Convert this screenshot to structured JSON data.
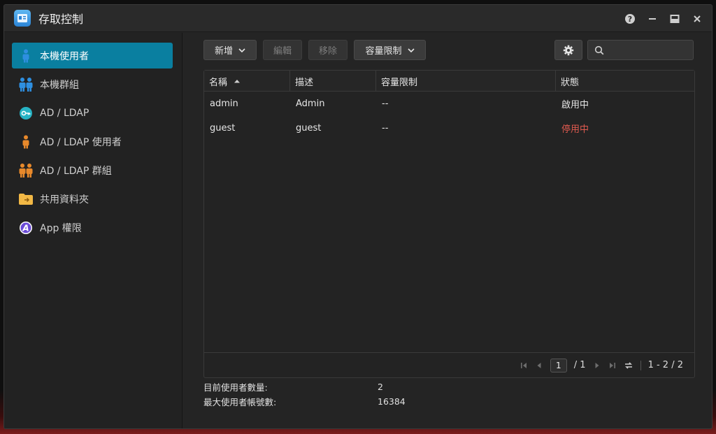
{
  "window": {
    "title": "存取控制"
  },
  "sidebar": {
    "items": [
      {
        "label": "本機使用者",
        "icon": "user-icon",
        "active": true
      },
      {
        "label": "本機群組",
        "icon": "group-icon",
        "active": false
      },
      {
        "label": "AD / LDAP",
        "icon": "key-icon",
        "active": false
      },
      {
        "label": "AD / LDAP 使用者",
        "icon": "user-icon",
        "active": false
      },
      {
        "label": "AD / LDAP 群組",
        "icon": "group-icon",
        "active": false
      },
      {
        "label": "共用資料夾",
        "icon": "folder-icon",
        "active": false
      },
      {
        "label": "App 權限",
        "icon": "app-icon",
        "active": false
      }
    ]
  },
  "toolbar": {
    "add_label": "新增",
    "edit_label": "編輯",
    "remove_label": "移除",
    "quota_label": "容量限制",
    "search_placeholder": ""
  },
  "table": {
    "columns": [
      "名稱",
      "描述",
      "容量限制",
      "狀態"
    ],
    "rows": [
      {
        "name": "admin",
        "description": "Admin",
        "quota": "--",
        "status": "啟用中"
      },
      {
        "name": "guest",
        "description": "guest",
        "quota": "--",
        "status": "停用中"
      }
    ]
  },
  "pagination": {
    "current_page": "1",
    "total_pages": "/ 1",
    "range": "1 - 2 / 2"
  },
  "stats": {
    "current_users_label": "目前使用者數量:",
    "current_users_value": "2",
    "max_users_label": "最大使用者帳號數:",
    "max_users_value": "16384"
  },
  "colors": {
    "accent": "#0a7fa0",
    "status_enabled": "#e6e6e6",
    "status_disabled": "#e05a4f",
    "user_icon": "#2e8fe0",
    "ldap_icon": "#e8892b"
  }
}
